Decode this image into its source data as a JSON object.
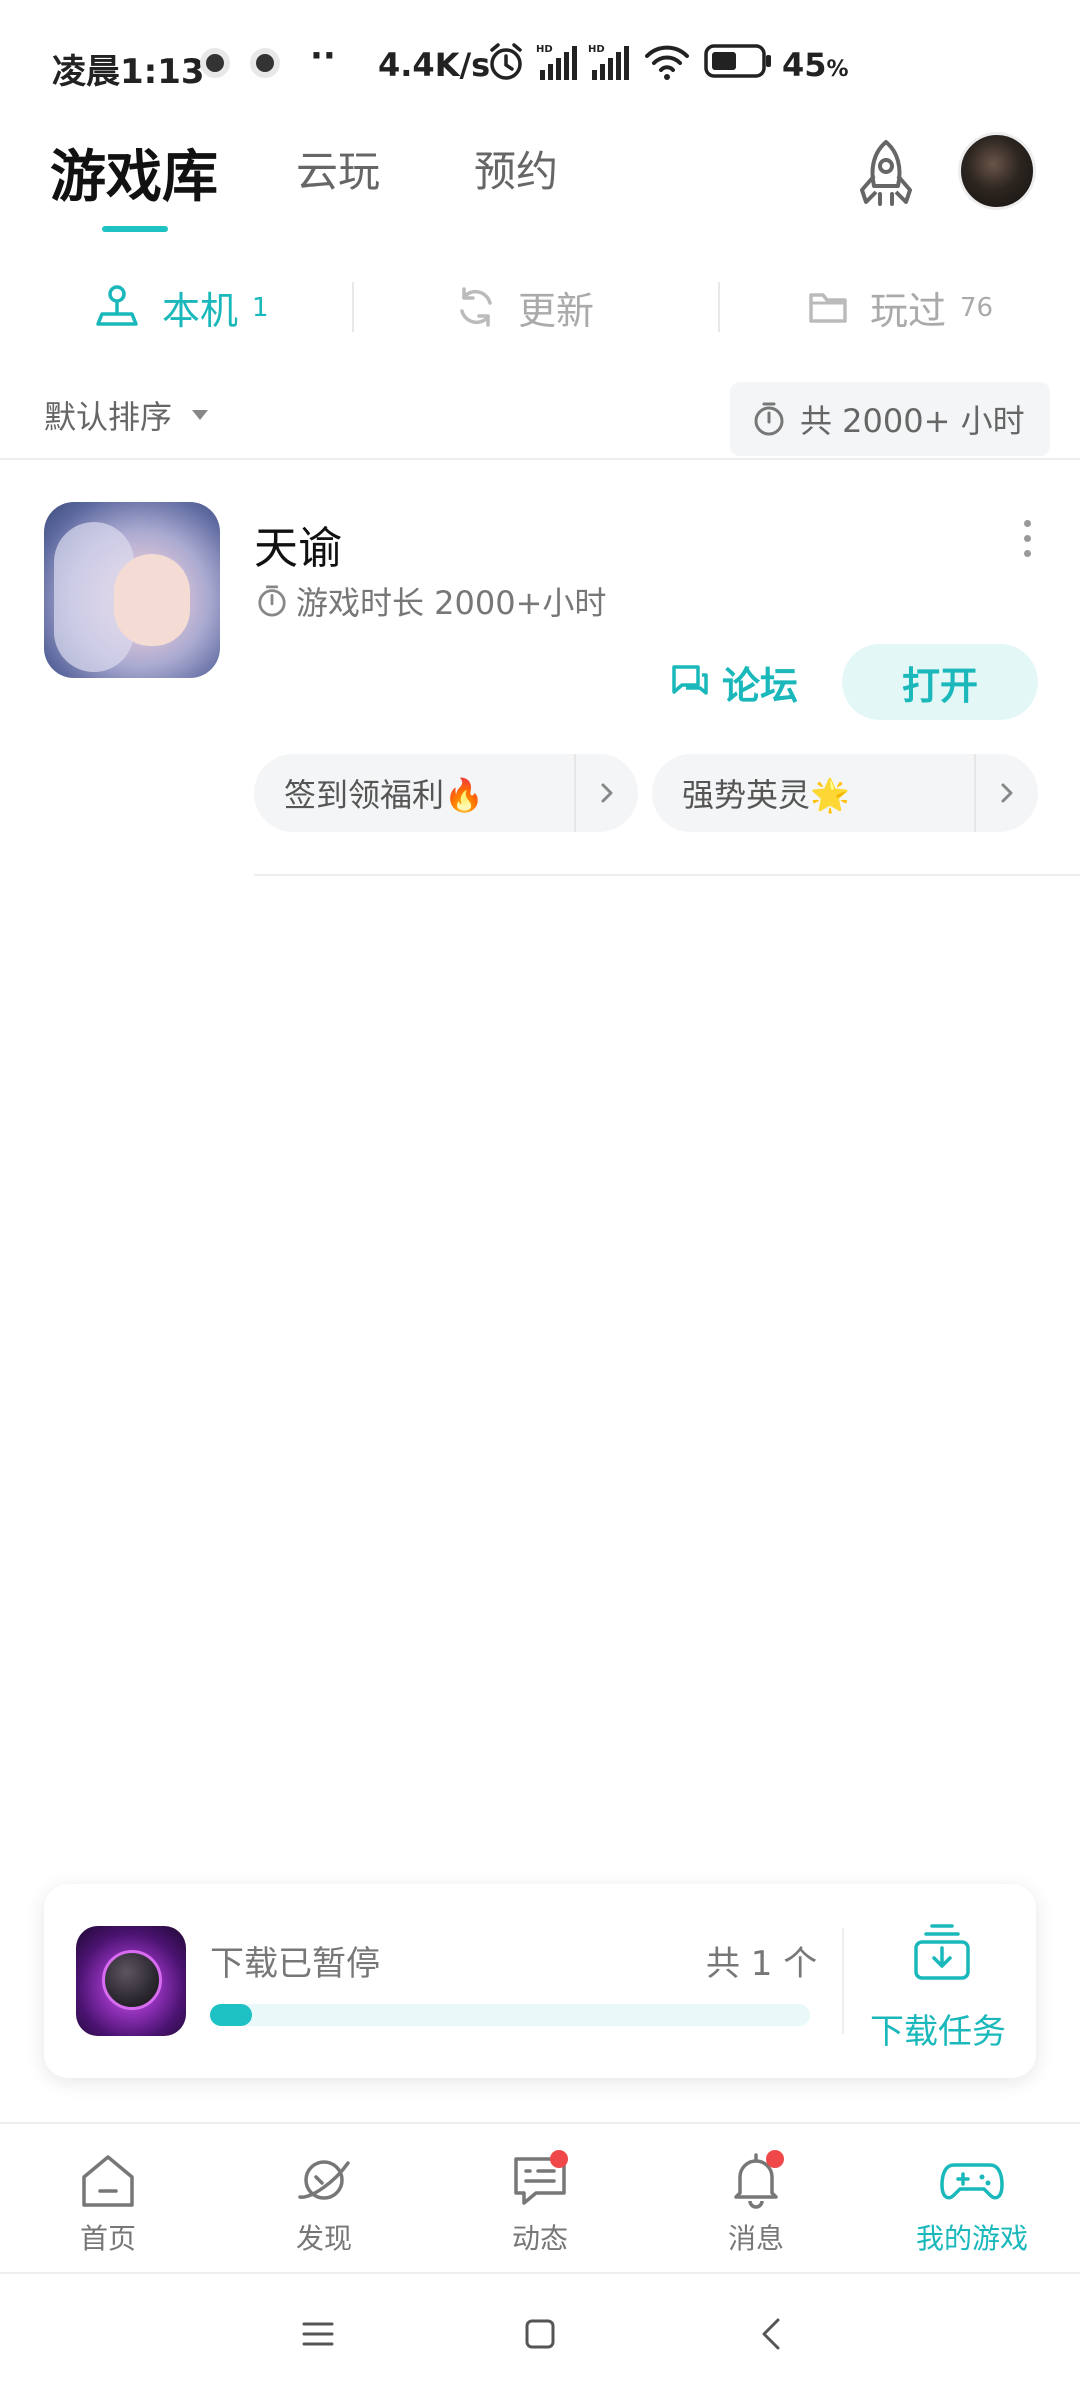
{
  "status_bar": {
    "time": "凌晨1:13",
    "dots": "··",
    "net_speed": "4.4K/s",
    "battery_pct": "45",
    "battery_unit": "%",
    "icons": [
      "notification-icon",
      "notification-icon",
      "alarm-icon",
      "signal-hd-icon",
      "signal-hd-icon",
      "wifi-icon",
      "battery-icon"
    ]
  },
  "header": {
    "tabs": [
      {
        "label": "游戏库",
        "active": true
      },
      {
        "label": "云玩",
        "active": false
      },
      {
        "label": "预约",
        "active": false
      }
    ],
    "rocket_icon": "rocket-icon",
    "avatar_icon": "avatar"
  },
  "subtabs": [
    {
      "label": "本机",
      "count": "1",
      "icon": "joystick-icon",
      "active": true
    },
    {
      "label": "更新",
      "count": "",
      "icon": "refresh-icon",
      "active": false
    },
    {
      "label": "玩过",
      "count": "76",
      "icon": "folder-icon",
      "active": false
    }
  ],
  "sort": {
    "label": "默认排序",
    "total_time": "共 2000+ 小时"
  },
  "game": {
    "title": "天谕",
    "playtime": "游戏时长 2000+小时",
    "forum_label": "论坛",
    "open_label": "打开",
    "chips": [
      {
        "label": "签到领福利🔥"
      },
      {
        "label": "强势英灵🌟"
      }
    ]
  },
  "download": {
    "status": "下载已暂停",
    "count": "共 1 个",
    "progress": 0.07,
    "task_label": "下载任务"
  },
  "bottom_nav": [
    {
      "label": "首页",
      "icon": "home-icon",
      "badge": false,
      "active": false
    },
    {
      "label": "发现",
      "icon": "planet-icon",
      "badge": false,
      "active": false
    },
    {
      "label": "动态",
      "icon": "chat-icon",
      "badge": true,
      "active": false
    },
    {
      "label": "消息",
      "icon": "bell-icon",
      "badge": true,
      "active": false
    },
    {
      "label": "我的游戏",
      "icon": "gamepad-icon",
      "badge": false,
      "active": true
    }
  ],
  "colors": {
    "accent": "#1ab8bb",
    "badge": "#f04848"
  }
}
